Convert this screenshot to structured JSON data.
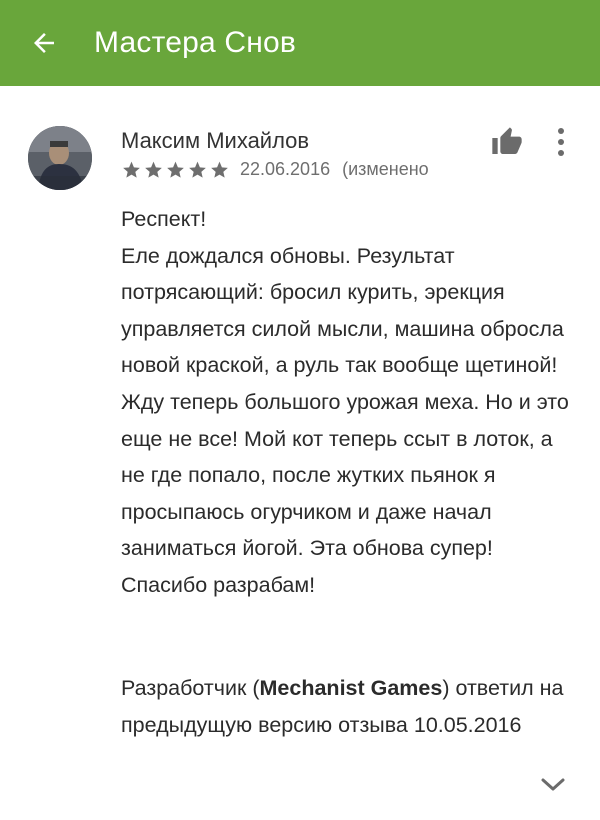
{
  "appbar": {
    "title": "Мастера Снов",
    "back_icon": "arrow-back-icon",
    "background_color": "#69a63b"
  },
  "review": {
    "author": "Максим Михайлов",
    "rating": 5,
    "rating_max": 5,
    "date": "22.06.2016",
    "edited_label": "(изменено",
    "text": "Респект!\nЕле дождался обновы. Результат потрясающий: бросил курить, эрекция управляется силой мысли, машина обросла новой краской, а руль так вообще щетиной! Жду теперь большого урожая меха. Но и это еще не все! Мой кот теперь ссыт в лоток, а не где попало, после жутких пьянок я просыпаюсь огурчиком и даже начал заниматься йогой. Эта обнова супер! Спасибо разрабам!",
    "like_icon": "thumbs-up-icon",
    "more_icon": "more-vert-icon"
  },
  "developer_reply": {
    "prefix": "Разработчик (",
    "developer_name": "Mechanist Games",
    "suffix": ") ответил на предыдущую версию отзыва 10.05.2016",
    "expand_icon": "chevron-down-icon"
  }
}
